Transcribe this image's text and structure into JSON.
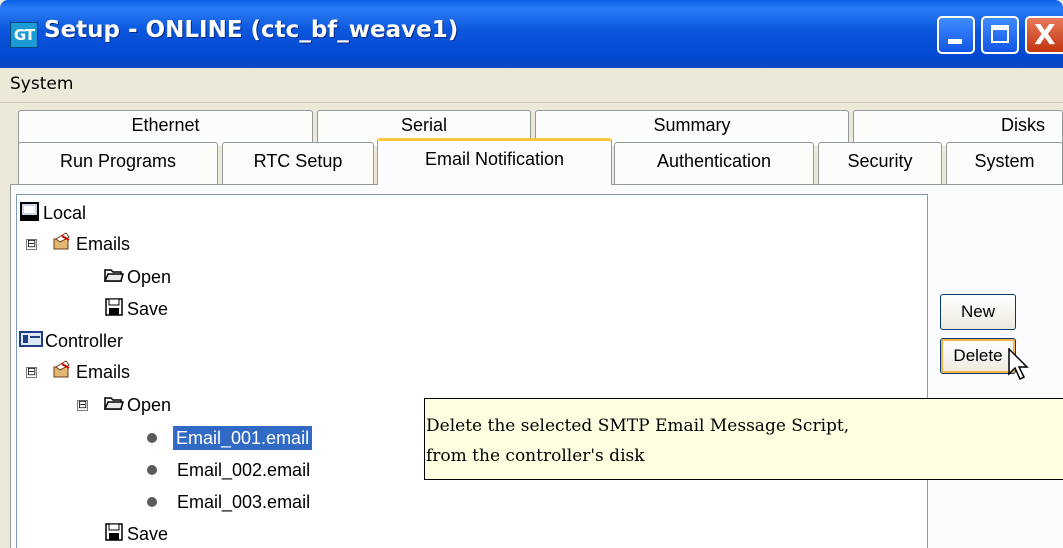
{
  "window": {
    "title": "Setup - ONLINE (ctc_bf_weave1)",
    "app_icon_text": "GT",
    "minimize_label": "_",
    "close_label": "X"
  },
  "menu": {
    "items": [
      {
        "label": "System"
      }
    ]
  },
  "tabs": {
    "back_row": [
      {
        "label": "Ethernet"
      },
      {
        "label": "Serial"
      },
      {
        "label": "Summary"
      },
      {
        "label": "Disks"
      }
    ],
    "front_row": [
      {
        "label": "Run Programs"
      },
      {
        "label": "RTC Setup"
      },
      {
        "label": "Email Notification",
        "active": true
      },
      {
        "label": "Authentication"
      },
      {
        "label": "Security"
      },
      {
        "label": "System"
      }
    ]
  },
  "tree": {
    "nodes": [
      {
        "label": "Local",
        "icon": "computer-icon"
      },
      {
        "label": "Emails",
        "icon": "email-folder-icon",
        "expander": "⊟"
      },
      {
        "label": "Open",
        "icon": "open-folder-icon"
      },
      {
        "label": "Save",
        "icon": "save-disk-icon"
      },
      {
        "label": "Controller",
        "icon": "controller-icon"
      },
      {
        "label": "Emails",
        "icon": "email-folder-icon",
        "expander": "⊟"
      },
      {
        "label": "Open",
        "icon": "open-folder-icon",
        "expander": "⊟"
      },
      {
        "label": "Email_001.email",
        "icon": "bullet-icon",
        "selected": true
      },
      {
        "label": "Email_002.email",
        "icon": "bullet-icon"
      },
      {
        "label": "Email_003.email",
        "icon": "bullet-icon"
      },
      {
        "label": "Save",
        "icon": "save-disk-icon"
      }
    ]
  },
  "buttons": {
    "new_label": "New",
    "delete_label": "Delete"
  },
  "tooltip": {
    "line1": "Delete the selected SMTP Email Message Script,",
    "line2": "from the controller's disk"
  },
  "colors": {
    "titlebar": "#0a4fd8",
    "selection": "#316ac5",
    "tooltip_bg": "#ffffe1",
    "active_tab_accent": "#ffc83c"
  }
}
